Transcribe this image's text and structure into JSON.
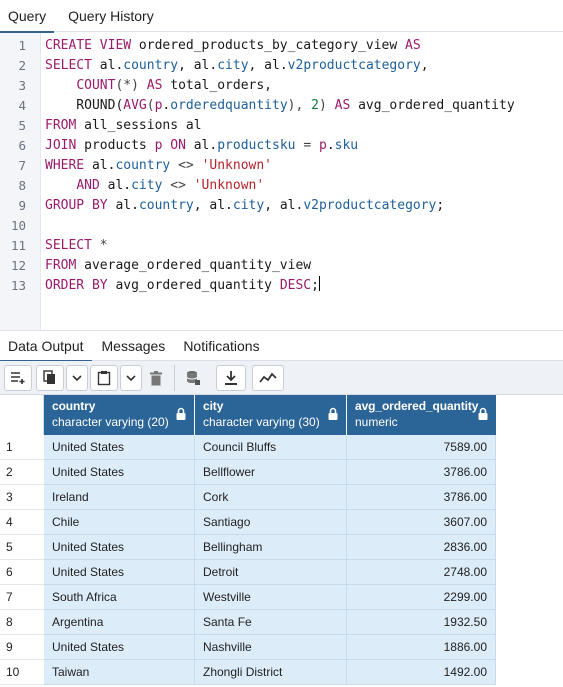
{
  "top_tabs": [
    "Query",
    "Query History"
  ],
  "editor": {
    "lines": [
      [
        [
          "kw",
          "CREATE VIEW "
        ],
        [
          "id",
          "ordered_products_by_category_view "
        ],
        [
          "kw",
          "AS"
        ]
      ],
      [
        [
          "kw",
          "SELECT "
        ],
        [
          "id",
          "al."
        ],
        [
          "prop",
          "country"
        ],
        [
          "id",
          ", al."
        ],
        [
          "prop",
          "city"
        ],
        [
          "id",
          ", al."
        ],
        [
          "prop",
          "v2productcategory"
        ],
        [
          "id",
          ","
        ]
      ],
      [
        [
          "id",
          "    "
        ],
        [
          "kw",
          "COUNT"
        ],
        [
          "op",
          "(*) "
        ],
        [
          "kw",
          "AS "
        ],
        [
          "id",
          "total_orders,"
        ]
      ],
      [
        [
          "id",
          "    ROUND("
        ],
        [
          "kw",
          "AVG"
        ],
        [
          "op",
          "("
        ],
        [
          "kw",
          "p"
        ],
        [
          "id",
          "."
        ],
        [
          "prop",
          "orderedquantity"
        ],
        [
          "op",
          "), "
        ],
        [
          "num",
          "2"
        ],
        [
          "op",
          ") "
        ],
        [
          "kw",
          "AS "
        ],
        [
          "id",
          "avg_ordered_quantity"
        ]
      ],
      [
        [
          "kw",
          "FROM "
        ],
        [
          "id",
          "all_sessions al"
        ]
      ],
      [
        [
          "kw",
          "JOIN "
        ],
        [
          "id",
          "products "
        ],
        [
          "kw",
          "p ON "
        ],
        [
          "id",
          "al."
        ],
        [
          "prop",
          "productsku"
        ],
        [
          "op",
          " = "
        ],
        [
          "kw",
          "p"
        ],
        [
          "id",
          "."
        ],
        [
          "prop",
          "sku"
        ]
      ],
      [
        [
          "kw",
          "WHERE "
        ],
        [
          "id",
          "al."
        ],
        [
          "prop",
          "country"
        ],
        [
          "op",
          " <> "
        ],
        [
          "str",
          "'Unknown'"
        ]
      ],
      [
        [
          "id",
          "    "
        ],
        [
          "kw",
          "AND "
        ],
        [
          "id",
          "al."
        ],
        [
          "prop",
          "city"
        ],
        [
          "op",
          " <> "
        ],
        [
          "str",
          "'Unknown'"
        ]
      ],
      [
        [
          "kw",
          "GROUP BY "
        ],
        [
          "id",
          "al."
        ],
        [
          "prop",
          "country"
        ],
        [
          "id",
          ", al."
        ],
        [
          "prop",
          "city"
        ],
        [
          "id",
          ", al."
        ],
        [
          "prop",
          "v2productcategory"
        ],
        [
          "id",
          ";"
        ]
      ],
      [],
      [
        [
          "kw",
          "SELECT "
        ],
        [
          "op",
          "*"
        ]
      ],
      [
        [
          "kw",
          "FROM "
        ],
        [
          "id",
          "average_ordered_quantity_view"
        ]
      ],
      [
        [
          "kw",
          "ORDER BY "
        ],
        [
          "id",
          "avg_ordered_quantity "
        ],
        [
          "kw",
          "DESC"
        ],
        [
          "id",
          ";"
        ]
      ]
    ]
  },
  "bottom_tabs": [
    "Data Output",
    "Messages",
    "Notifications"
  ],
  "toolbar_icons": [
    "add-row-icon",
    "copy-icon",
    "chevron-down-icon",
    "paste-icon",
    "chevron-down-icon",
    "delete-icon",
    "save-data-icon",
    "download-icon",
    "graph-icon"
  ],
  "table": {
    "columns": [
      {
        "name": "country",
        "type": "character varying (20)"
      },
      {
        "name": "city",
        "type": "character varying (30)"
      },
      {
        "name": "avg_ordered_quantity",
        "type": "numeric"
      }
    ],
    "rows": [
      [
        "1",
        "United States",
        "Council Bluffs",
        "7589.00"
      ],
      [
        "2",
        "United States",
        "Bellflower",
        "3786.00"
      ],
      [
        "3",
        "Ireland",
        "Cork",
        "3786.00"
      ],
      [
        "4",
        "Chile",
        "Santiago",
        "3607.00"
      ],
      [
        "5",
        "United States",
        "Bellingham",
        "2836.00"
      ],
      [
        "6",
        "United States",
        "Detroit",
        "2748.00"
      ],
      [
        "7",
        "South Africa",
        "Westville",
        "2299.00"
      ],
      [
        "8",
        "Argentina",
        "Santa Fe",
        "1932.50"
      ],
      [
        "9",
        "United States",
        "Nashville",
        "1886.00"
      ],
      [
        "10",
        "Taiwan",
        "Zhongli District",
        "1492.00"
      ]
    ]
  },
  "colors": {
    "header_bg": "#2b6496",
    "cell_bg": "#dcecf8",
    "accent": "#326690"
  }
}
